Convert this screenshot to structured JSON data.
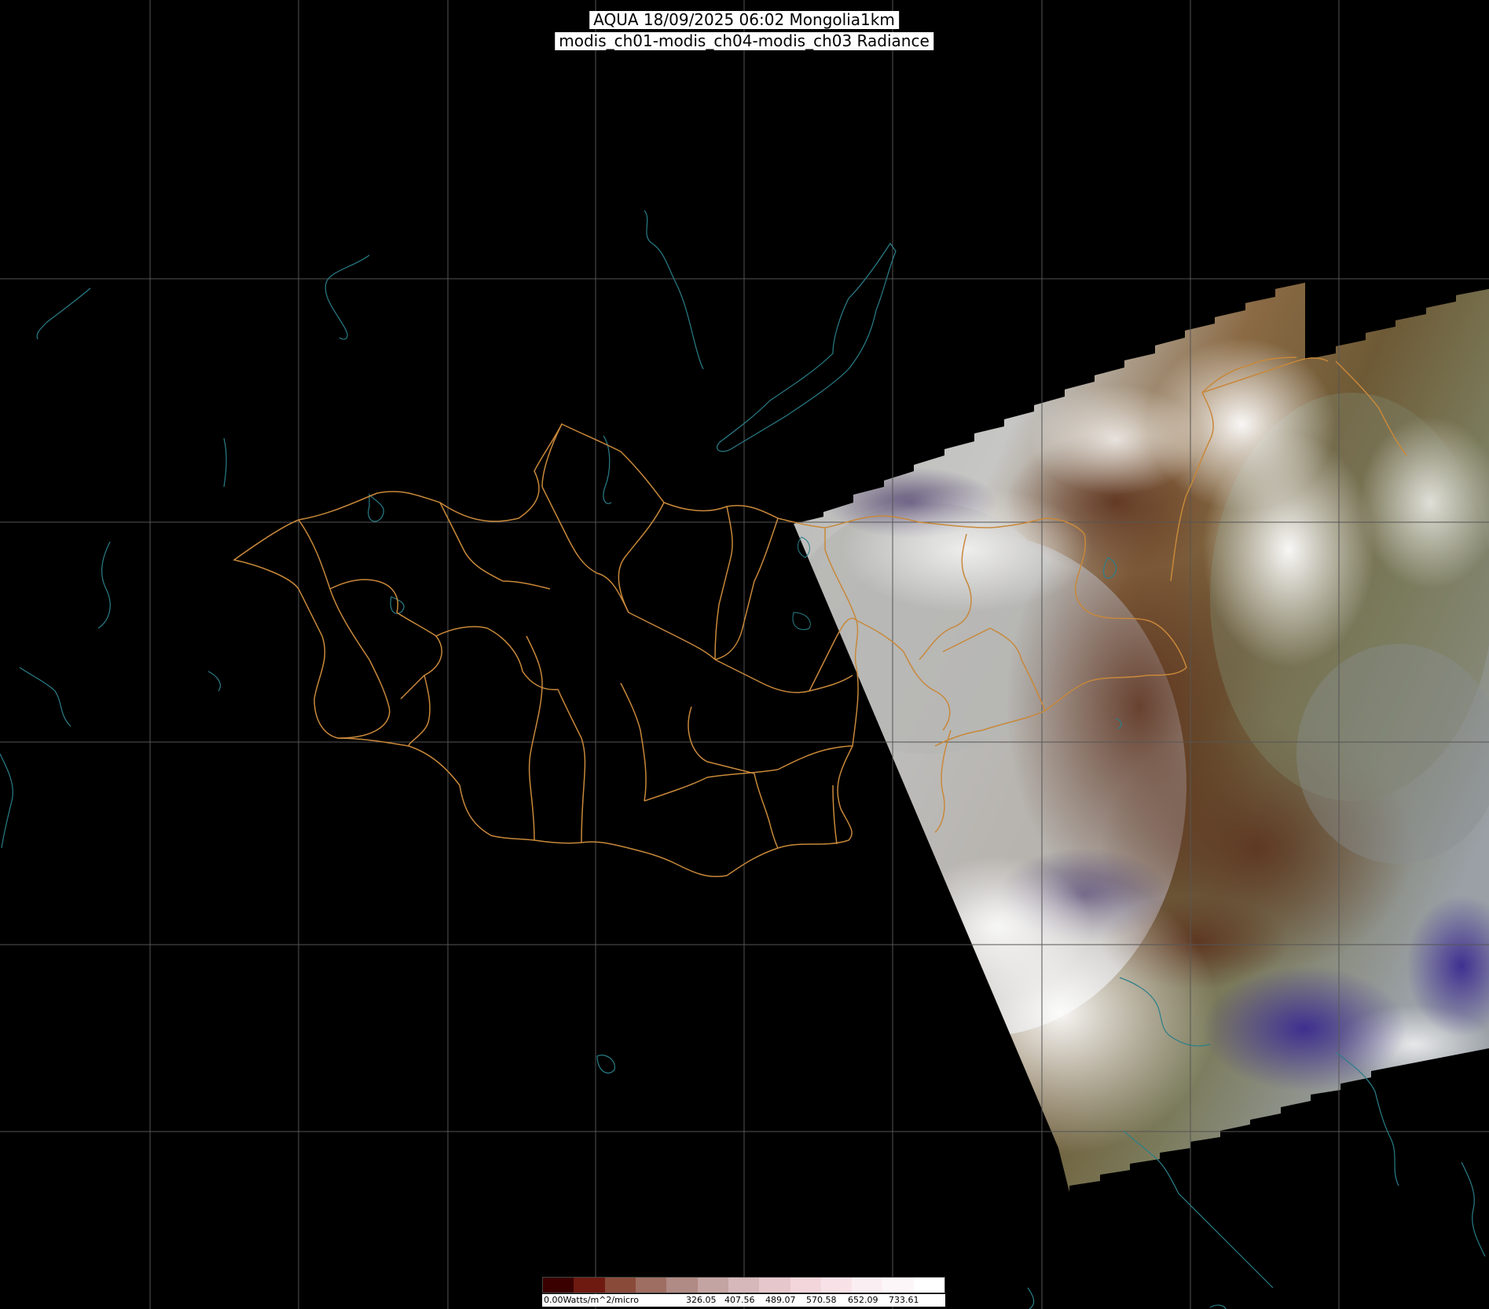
{
  "title": {
    "line1": "AQUA 18/09/2025 06:02 Mongolia1km",
    "line2": "modis_ch01-modis_ch04-modis_ch03 Radiance"
  },
  "legend": {
    "unit_label": "0.00Watts/m^2/micro",
    "ticks": [
      "326.05",
      "407.56",
      "489.07",
      "570.58",
      "652.09",
      "733.61"
    ],
    "colors": [
      "#3a0000",
      "#6e1a10",
      "#8a4a3a",
      "#9e6e62",
      "#b08a84",
      "#c4a4a2",
      "#d6b8ba",
      "#e6c8cc",
      "#f2d6dc",
      "#f8e2e8",
      "#fbeef2",
      "#fdf6f8",
      "#ffffff"
    ]
  },
  "colors": {
    "grid": "#555555",
    "borders": "#c8883a",
    "coast": "#2a7f8a"
  }
}
